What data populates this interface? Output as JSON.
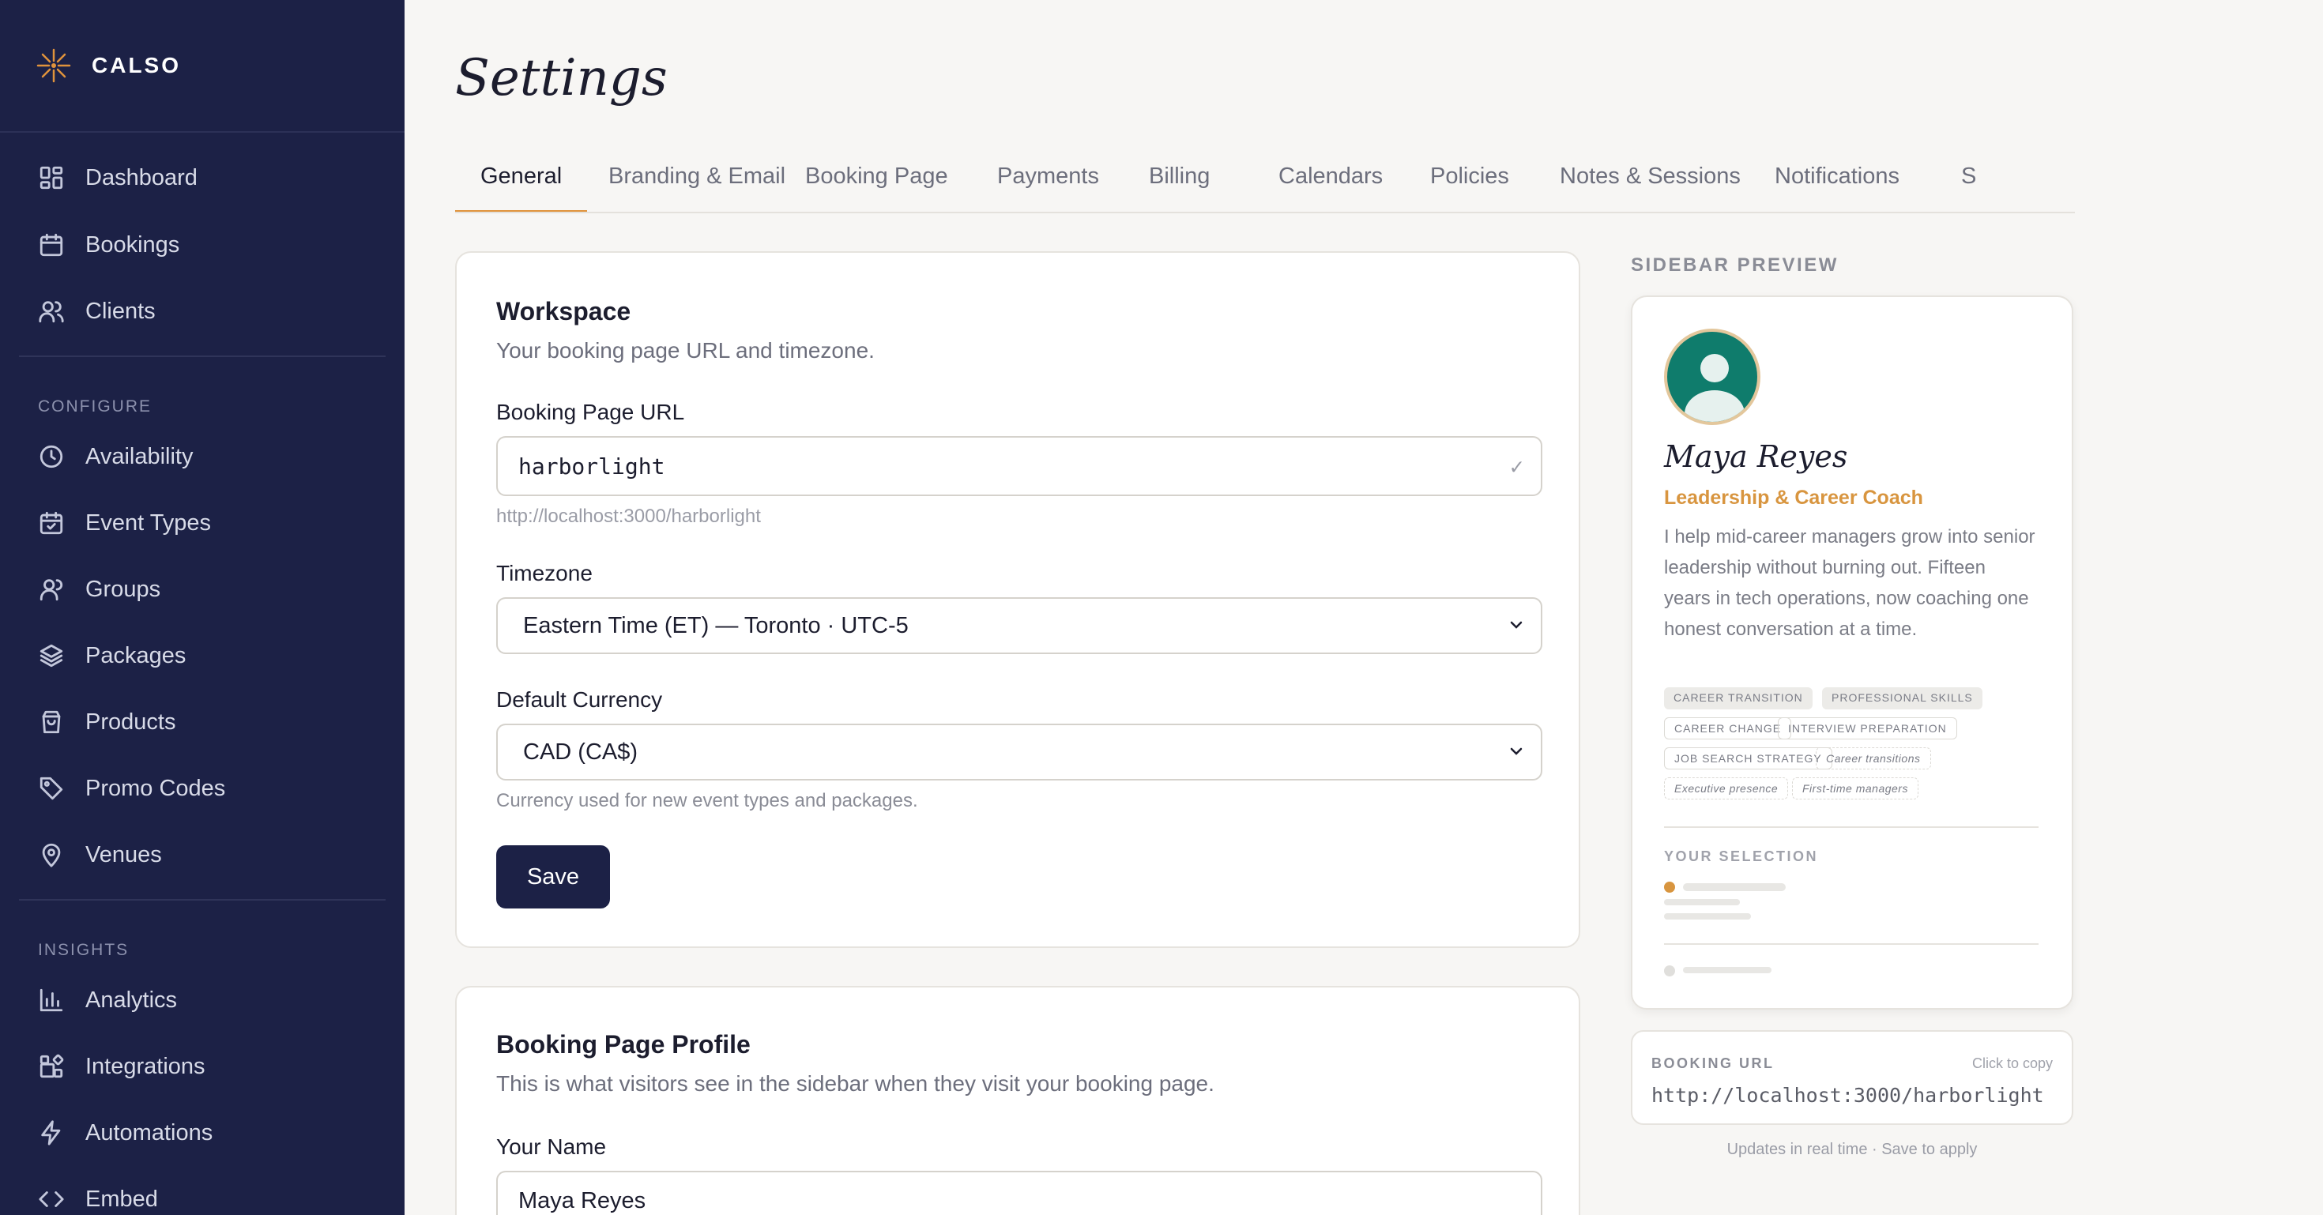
{
  "brand": {
    "name": "CALSO"
  },
  "nav": {
    "top": [
      {
        "label": "Dashboard",
        "icon": "grid-icon"
      },
      {
        "label": "Bookings",
        "icon": "calendar-icon"
      },
      {
        "label": "Clients",
        "icon": "users-icon"
      }
    ],
    "configure_heading": "CONFIGURE",
    "configure": [
      {
        "label": "Availability",
        "icon": "clock-icon"
      },
      {
        "label": "Event Types",
        "icon": "calendar-check-icon"
      },
      {
        "label": "Groups",
        "icon": "group-icon"
      },
      {
        "label": "Packages",
        "icon": "layers-icon"
      },
      {
        "label": "Products",
        "icon": "shopping-bag-icon"
      },
      {
        "label": "Promo Codes",
        "icon": "tag-icon"
      },
      {
        "label": "Venues",
        "icon": "map-pin-icon"
      }
    ],
    "insights_heading": "INSIGHTS",
    "insights": [
      {
        "label": "Analytics",
        "icon": "bar-chart-icon"
      },
      {
        "label": "Integrations",
        "icon": "puzzle-icon"
      },
      {
        "label": "Automations",
        "icon": "lightning-icon"
      },
      {
        "label": "Embed",
        "icon": "code-icon"
      }
    ]
  },
  "page": {
    "title": "Settings"
  },
  "tabs": [
    "General",
    "Branding & Email",
    "Booking Page",
    "Payments",
    "Billing",
    "Calendars",
    "Policies",
    "Notes & Sessions",
    "Notifications",
    "S"
  ],
  "workspace": {
    "title": "Workspace",
    "subtitle": "Your booking page URL and timezone.",
    "url_label": "Booking Page URL",
    "url_value": "harborlight",
    "url_check": "✓",
    "url_hint": "http://localhost:3000/harborlight",
    "timezone_label": "Timezone",
    "timezone_value": "Eastern Time (ET) — Toronto · UTC-5",
    "currency_label": "Default Currency",
    "currency_value": "CAD (CA$)",
    "currency_hint": "Currency used for new event types and packages.",
    "save_label": "Save"
  },
  "profile": {
    "title": "Booking Page Profile",
    "subtitle": "This is what visitors see in the sidebar when they visit your booking page.",
    "name_label": "Your Name",
    "name_value": "Maya Reyes"
  },
  "preview": {
    "heading": "SIDEBAR PREVIEW",
    "name": "Maya Reyes",
    "role": "Leadership & Career Coach",
    "bio": "I help mid-career managers grow into senior leadership without burning out. Fifteen years in tech operations, now coaching one honest conversation at a time.",
    "tags_filled": [
      "CAREER TRANSITION",
      "PROFESSIONAL SKILLS"
    ],
    "tags_outline": [
      "CAREER CHANGE",
      "INTERVIEW PREPARATION",
      "JOB SEARCH STRATEGY"
    ],
    "tags_dashed": [
      "Career transitions",
      "Executive presence",
      "First-time managers"
    ],
    "selection_label": "YOUR SELECTION",
    "url_label": "BOOKING URL",
    "url_copy": "Click to copy",
    "url_value": "http://localhost:3000/harborlight",
    "footnote": "Updates in real time · Save to apply"
  },
  "colors": {
    "sidebar": "#1c2146",
    "accent": "#e0933c",
    "avatar": "#0f7c6c"
  }
}
